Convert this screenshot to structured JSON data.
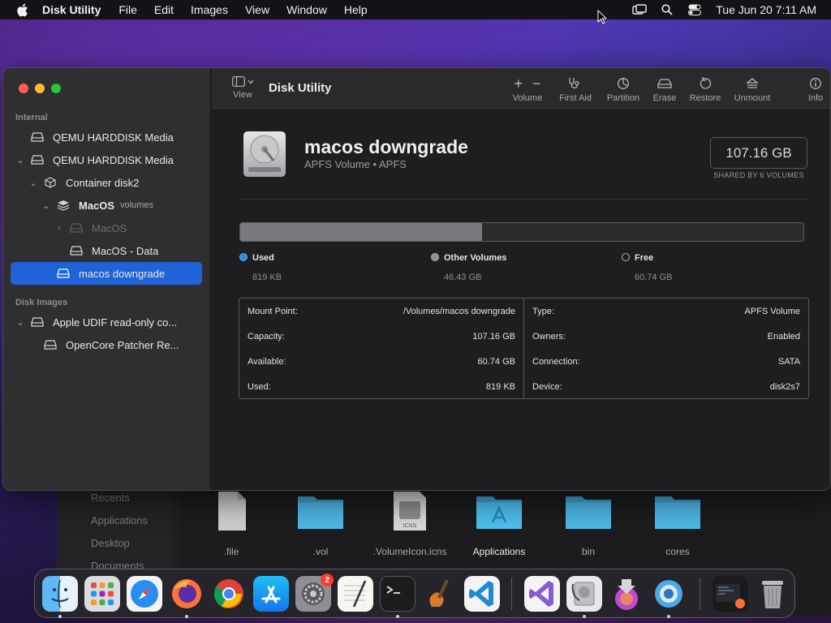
{
  "menubar": {
    "app": "Disk Utility",
    "items": [
      "File",
      "Edit",
      "Images",
      "View",
      "Window",
      "Help"
    ],
    "clock": "Tue Jun 20  7:11 AM"
  },
  "finder": {
    "sidebar": [
      "Recents",
      "Applications",
      "Desktop",
      "Documents"
    ],
    "files": [
      {
        "name": ".file",
        "icon": "document-icon"
      },
      {
        "name": ".vol",
        "icon": "folder-icon"
      },
      {
        "name": ".VolumeIcon.icns",
        "icon": "icns-icon"
      },
      {
        "name": "Applications",
        "icon": "applications-folder-icon"
      },
      {
        "name": "bin",
        "icon": "folder-icon"
      },
      {
        "name": "cores",
        "icon": "folder-icon"
      }
    ]
  },
  "sidebar": {
    "internal_label": "Internal",
    "disk_images_label": "Disk Images",
    "items": [
      {
        "label": "QEMU HARDDISK Media"
      },
      {
        "label": "QEMU HARDDISK Media"
      },
      {
        "label": "Container disk2"
      },
      {
        "label": "MacOS",
        "sub": "volumes"
      },
      {
        "label": "MacOS"
      },
      {
        "label": "MacOS - Data"
      },
      {
        "label": "macos downgrade"
      },
      {
        "label": "Apple UDIF read-only co..."
      },
      {
        "label": "OpenCore Patcher Re..."
      }
    ]
  },
  "toolbar": {
    "view_label": "View",
    "title": "Disk Utility",
    "volume_label": "Volume",
    "first_aid_label": "First Aid",
    "partition_label": "Partition",
    "erase_label": "Erase",
    "restore_label": "Restore",
    "unmount_label": "Unmount",
    "info_label": "Info"
  },
  "volume": {
    "name": "macos downgrade",
    "subtitle": "APFS Volume • APFS",
    "size": "107.16 GB",
    "shared": "SHARED BY 6 VOLUMES",
    "used_fraction": 0.43,
    "colors": {
      "used": "#2d8ddf",
      "other": "#8e8e92",
      "free": "#2b2b2d",
      "selected": "#1f63d8"
    }
  },
  "usage": {
    "used_label": "Used",
    "used_value": "819 KB",
    "other_label": "Other Volumes",
    "other_value": "46.43 GB",
    "free_label": "Free",
    "free_value": "60.74 GB"
  },
  "info": {
    "left": [
      {
        "k": "Mount Point:",
        "v": "/Volumes/macos downgrade"
      },
      {
        "k": "Capacity:",
        "v": "107.16 GB"
      },
      {
        "k": "Available:",
        "v": "60.74 GB"
      },
      {
        "k": "Used:",
        "v": "819 KB"
      }
    ],
    "right": [
      {
        "k": "Type:",
        "v": "APFS Volume"
      },
      {
        "k": "Owners:",
        "v": "Enabled"
      },
      {
        "k": "Connection:",
        "v": "SATA"
      },
      {
        "k": "Device:",
        "v": "disk2s7"
      }
    ]
  },
  "dock": {
    "settings_badge": "2",
    "apps": [
      "finder-icon",
      "launchpad-icon",
      "safari-icon",
      "firefox-icon",
      "chrome-icon",
      "app-store-icon",
      "system-settings-icon",
      "textedit-icon",
      "terminal-icon",
      "instruments-icon",
      "vscode-icon",
      "visual-studio-icon",
      "disk-utility-icon",
      "installer-icon",
      "opencore-icon",
      "downloads-stack-icon",
      "trash-icon"
    ]
  }
}
